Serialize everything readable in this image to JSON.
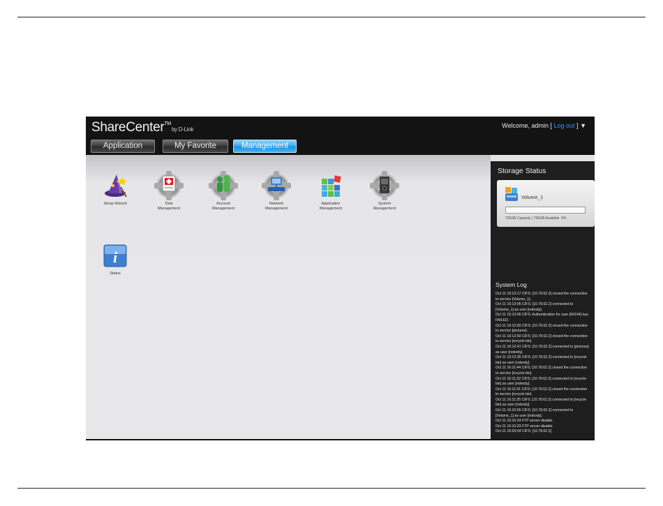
{
  "header": {
    "brand": "ShareCenter",
    "brand_tm": "TM",
    "brand_by": "by D-Link",
    "welcome_prefix": "Welcome, admin [",
    "logout_label": "Log out",
    "welcome_suffix": "] ▼"
  },
  "tabs": {
    "application": "Application",
    "favorite": "My Favorite",
    "management": "Management"
  },
  "icons": {
    "setup_wizard": "Setup Wizard",
    "disk_line1": "Disk",
    "disk_line2": "Management",
    "account_line1": "Account",
    "account_line2": "Management",
    "network_line1": "Network",
    "network_line2": "Management",
    "application_line1": "Application",
    "application_line2": "Management",
    "system_line1": "System",
    "system_line2": "Management",
    "status": "Status"
  },
  "storage": {
    "title": "Storage Status",
    "volume_name": "Volume_1",
    "capacity_text": "735GB Capacity / 735GB Available",
    "usage_percent": "0%",
    "usage_fraction": 0
  },
  "log": {
    "title": "System Log",
    "entries": [
      "Oct 11 16:13:17 CIFS: [10.78.62.2] closed the connection to service [Volume_1].",
      "Oct 11 16:13:06 CIFS: [10.78.62.2] connected to [Volume_1] as user [nobody].",
      "Oct 11 16:13:06 CIFS: Authentication for user [04144] has FAILED.",
      "Oct 11 16:12:50 CIFS: [10.78.62.2] closed the connection to service [pictures].",
      "Oct 11 16:12:50 CIFS: [10.78.62.2] closed the connection to service [recycle bin].",
      "Oct 11 16:12:41 CIFS: [10.78.62.2] connected to [pictures] as user [nobody].",
      "Oct 11 16:12:35 CIFS: [10.78.62.2] connected to [recycle bin] as user [nobody].",
      "Oct 11 16:11:44 CIFS: [10.78.62.2] closed the connection to service [recycle bin].",
      "Oct 11 16:11:32 CIFS: [10.78.62.2] connected to [recycle bin] as user [nobody].",
      "Oct 11 16:11:31 CIFS: [10.78.62.2] closed the connection to service [recycle bin].",
      "Oct 11 16:11:25 CIFS: [10.78.62.2] connected to [recycle bin] as user [nobody].",
      "Oct 11 16:10:55 CIFS: [10.78.62.2] connected to [Volume_1] as user [nobody].",
      "Oct 11 16:10:24 FTP server disable.",
      "Oct 11 16:10:23 FTP server disable.",
      "Oct 11 15:59:04 CIFS: [10.78.62.2]"
    ]
  }
}
